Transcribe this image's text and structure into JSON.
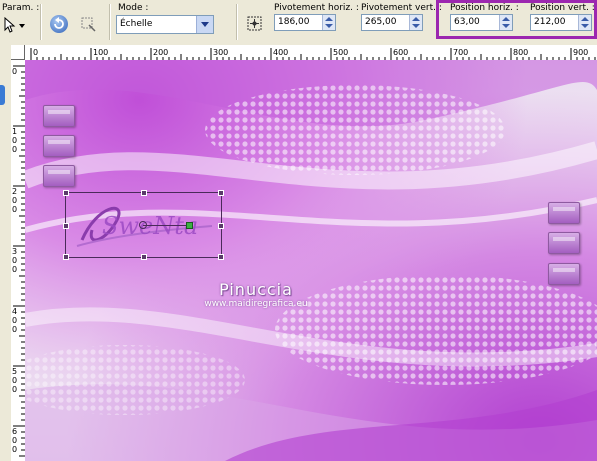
{
  "toolbar": {
    "param_label": "Param. :",
    "mode_label": "Mode :",
    "mode_value": "Échelle",
    "pivot_h_label": "Pivotement horiz. :",
    "pivot_h_value": "186,00",
    "pivot_v_label": "Pivotement vert. :",
    "pivot_v_value": "265,00",
    "pos_h_label": "Position horiz. :",
    "pos_h_value": "63,00",
    "pos_v_label": "Position vert. :",
    "pos_v_value": "212,00",
    "highlight_color": "#9c27b0"
  },
  "ruler": {
    "h_ticks": [
      "0",
      "100",
      "200",
      "300",
      "400",
      "500",
      "600",
      "700",
      "800",
      "900"
    ],
    "v_ticks": [
      "0",
      "100",
      "200",
      "300",
      "400",
      "500",
      "600"
    ]
  },
  "canvas": {
    "watermark_name": "Pinuccia",
    "watermark_url": "www.maidiregrafica.eu",
    "logo_text": "SweNta",
    "accent": "#b13fd0"
  }
}
